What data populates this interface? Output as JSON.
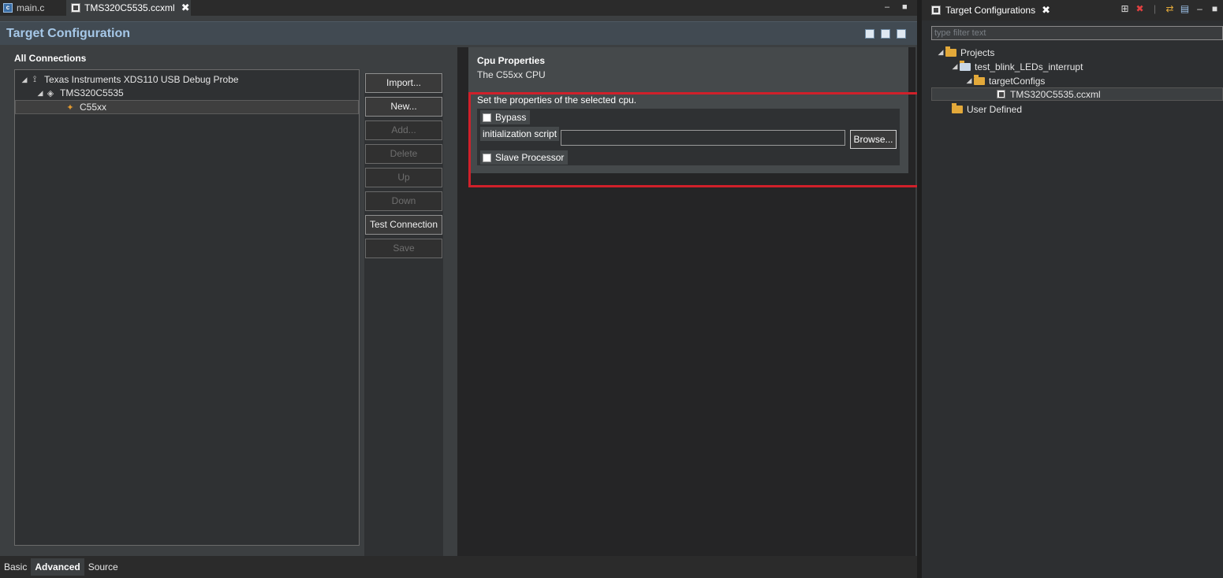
{
  "editor_tabs": [
    {
      "label": "main.c",
      "active": false
    },
    {
      "label": "TMS320C5535.ccxml",
      "active": true,
      "close": "✖"
    }
  ],
  "window_controls": {
    "minimize": "–",
    "maximize": "■"
  },
  "page_title": "Target Configuration",
  "connections": {
    "heading": "All Connections",
    "tree": [
      {
        "label": "Texas Instruments XDS110 USB Debug Probe",
        "icon": "probe-icon"
      },
      {
        "label": "TMS320C5535",
        "icon": "chip-icon"
      },
      {
        "label": "C55xx",
        "icon": "cpu-icon",
        "selected": true
      }
    ]
  },
  "buttons": {
    "import": "Import...",
    "new": "New...",
    "add": "Add...",
    "delete": "Delete",
    "up": "Up",
    "down": "Down",
    "test_connection": "Test Connection",
    "save": "Save"
  },
  "cpu_props": {
    "title": "Cpu Properties",
    "description": "The C55xx CPU",
    "set_text": "Set the properties of the selected cpu.",
    "bypass_label": "Bypass",
    "init_script_label": "initialization script",
    "init_script_value": "",
    "browse_label": "Browse...",
    "slave_label": "Slave Processor"
  },
  "bottom_tabs": [
    {
      "label": "Basic",
      "active": false
    },
    {
      "label": "Advanced",
      "active": true
    },
    {
      "label": "Source",
      "active": false
    }
  ],
  "right_view": {
    "title": "Target Configurations",
    "close": "✖",
    "filter_placeholder": "type filter text",
    "tree": [
      {
        "label": "Projects"
      },
      {
        "label": "test_blink_LEDs_interrupt"
      },
      {
        "label": "targetConfigs"
      },
      {
        "label": "TMS320C5535.ccxml",
        "selected": true
      },
      {
        "label": "User Defined"
      }
    ]
  },
  "colors": {
    "highlight": "#d0202a",
    "title_text": "#a6c8e8",
    "folder": "#e3a93a"
  }
}
